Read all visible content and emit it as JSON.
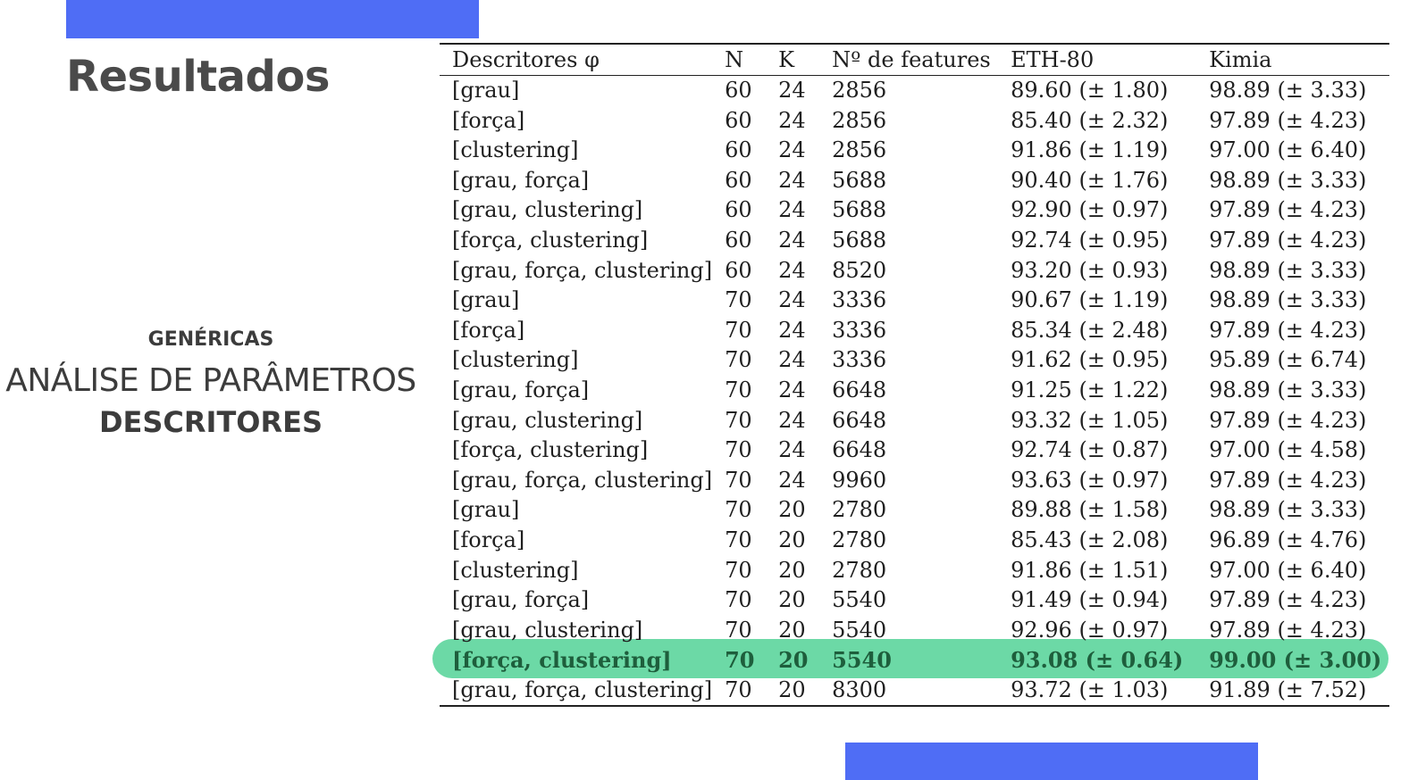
{
  "slide": {
    "title": "Resultados",
    "side": {
      "subtitle": "GENÉRICAS",
      "main": "ANÁLISE DE PARÂMETROS",
      "strong": "DESCRITORES"
    }
  },
  "colors": {
    "accent": "#4f6df5",
    "highlight": "#6cd9a6",
    "title": "#4a4a4a"
  },
  "table": {
    "headers": [
      "Descritores φ",
      "N",
      "K",
      "Nº de features",
      "ETH-80",
      "Kimia"
    ],
    "highlighted_row": 19,
    "rows": [
      [
        "[grau]",
        "60",
        "24",
        "2856",
        "89.60 (± 1.80)",
        "98.89 (± 3.33)"
      ],
      [
        "[força]",
        "60",
        "24",
        "2856",
        "85.40 (± 2.32)",
        "97.89 (± 4.23)"
      ],
      [
        "[clustering]",
        "60",
        "24",
        "2856",
        "91.86 (± 1.19)",
        "97.00 (± 6.40)"
      ],
      [
        "[grau, força]",
        "60",
        "24",
        "5688",
        "90.40 (± 1.76)",
        "98.89 (± 3.33)"
      ],
      [
        "[grau, clustering]",
        "60",
        "24",
        "5688",
        "92.90 (± 0.97)",
        "97.89 (± 4.23)"
      ],
      [
        "[força, clustering]",
        "60",
        "24",
        "5688",
        "92.74 (± 0.95)",
        "97.89 (± 4.23)"
      ],
      [
        "[grau, força, clustering]",
        "60",
        "24",
        "8520",
        "93.20 (± 0.93)",
        "98.89 (± 3.33)"
      ],
      [
        "[grau]",
        "70",
        "24",
        "3336",
        "90.67 (± 1.19)",
        "98.89 (± 3.33)"
      ],
      [
        "[força]",
        "70",
        "24",
        "3336",
        "85.34 (± 2.48)",
        "97.89 (± 4.23)"
      ],
      [
        "[clustering]",
        "70",
        "24",
        "3336",
        "91.62 (± 0.95)",
        "95.89 (± 6.74)"
      ],
      [
        "[grau, força]",
        "70",
        "24",
        "6648",
        "91.25 (± 1.22)",
        "98.89 (± 3.33)"
      ],
      [
        "[grau, clustering]",
        "70",
        "24",
        "6648",
        "93.32 (± 1.05)",
        "97.89 (± 4.23)"
      ],
      [
        "[força, clustering]",
        "70",
        "24",
        "6648",
        "92.74 (± 0.87)",
        "97.00 (± 4.58)"
      ],
      [
        "[grau, força, clustering]",
        "70",
        "24",
        "9960",
        "93.63 (± 0.97)",
        "97.89 (± 4.23)"
      ],
      [
        "[grau]",
        "70",
        "20",
        "2780",
        "89.88 (± 1.58)",
        "98.89 (± 3.33)"
      ],
      [
        "[força]",
        "70",
        "20",
        "2780",
        "85.43 (± 2.08)",
        "96.89 (± 4.76)"
      ],
      [
        "[clustering]",
        "70",
        "20",
        "2780",
        "91.86 (± 1.51)",
        "97.00 (± 6.40)"
      ],
      [
        "[grau, força]",
        "70",
        "20",
        "5540",
        "91.49 (± 0.94)",
        "97.89 (± 4.23)"
      ],
      [
        "[grau, clustering]",
        "70",
        "20",
        "5540",
        "92.96 (± 0.97)",
        "97.89 (± 4.23)"
      ],
      [
        "[força, clustering]",
        "70",
        "20",
        "5540",
        "93.08 (± 0.64)",
        "99.00 (± 3.00)"
      ],
      [
        "[grau, força, clustering]",
        "70",
        "20",
        "8300",
        "93.72 (± 1.03)",
        "91.89 (± 7.52)"
      ]
    ]
  }
}
